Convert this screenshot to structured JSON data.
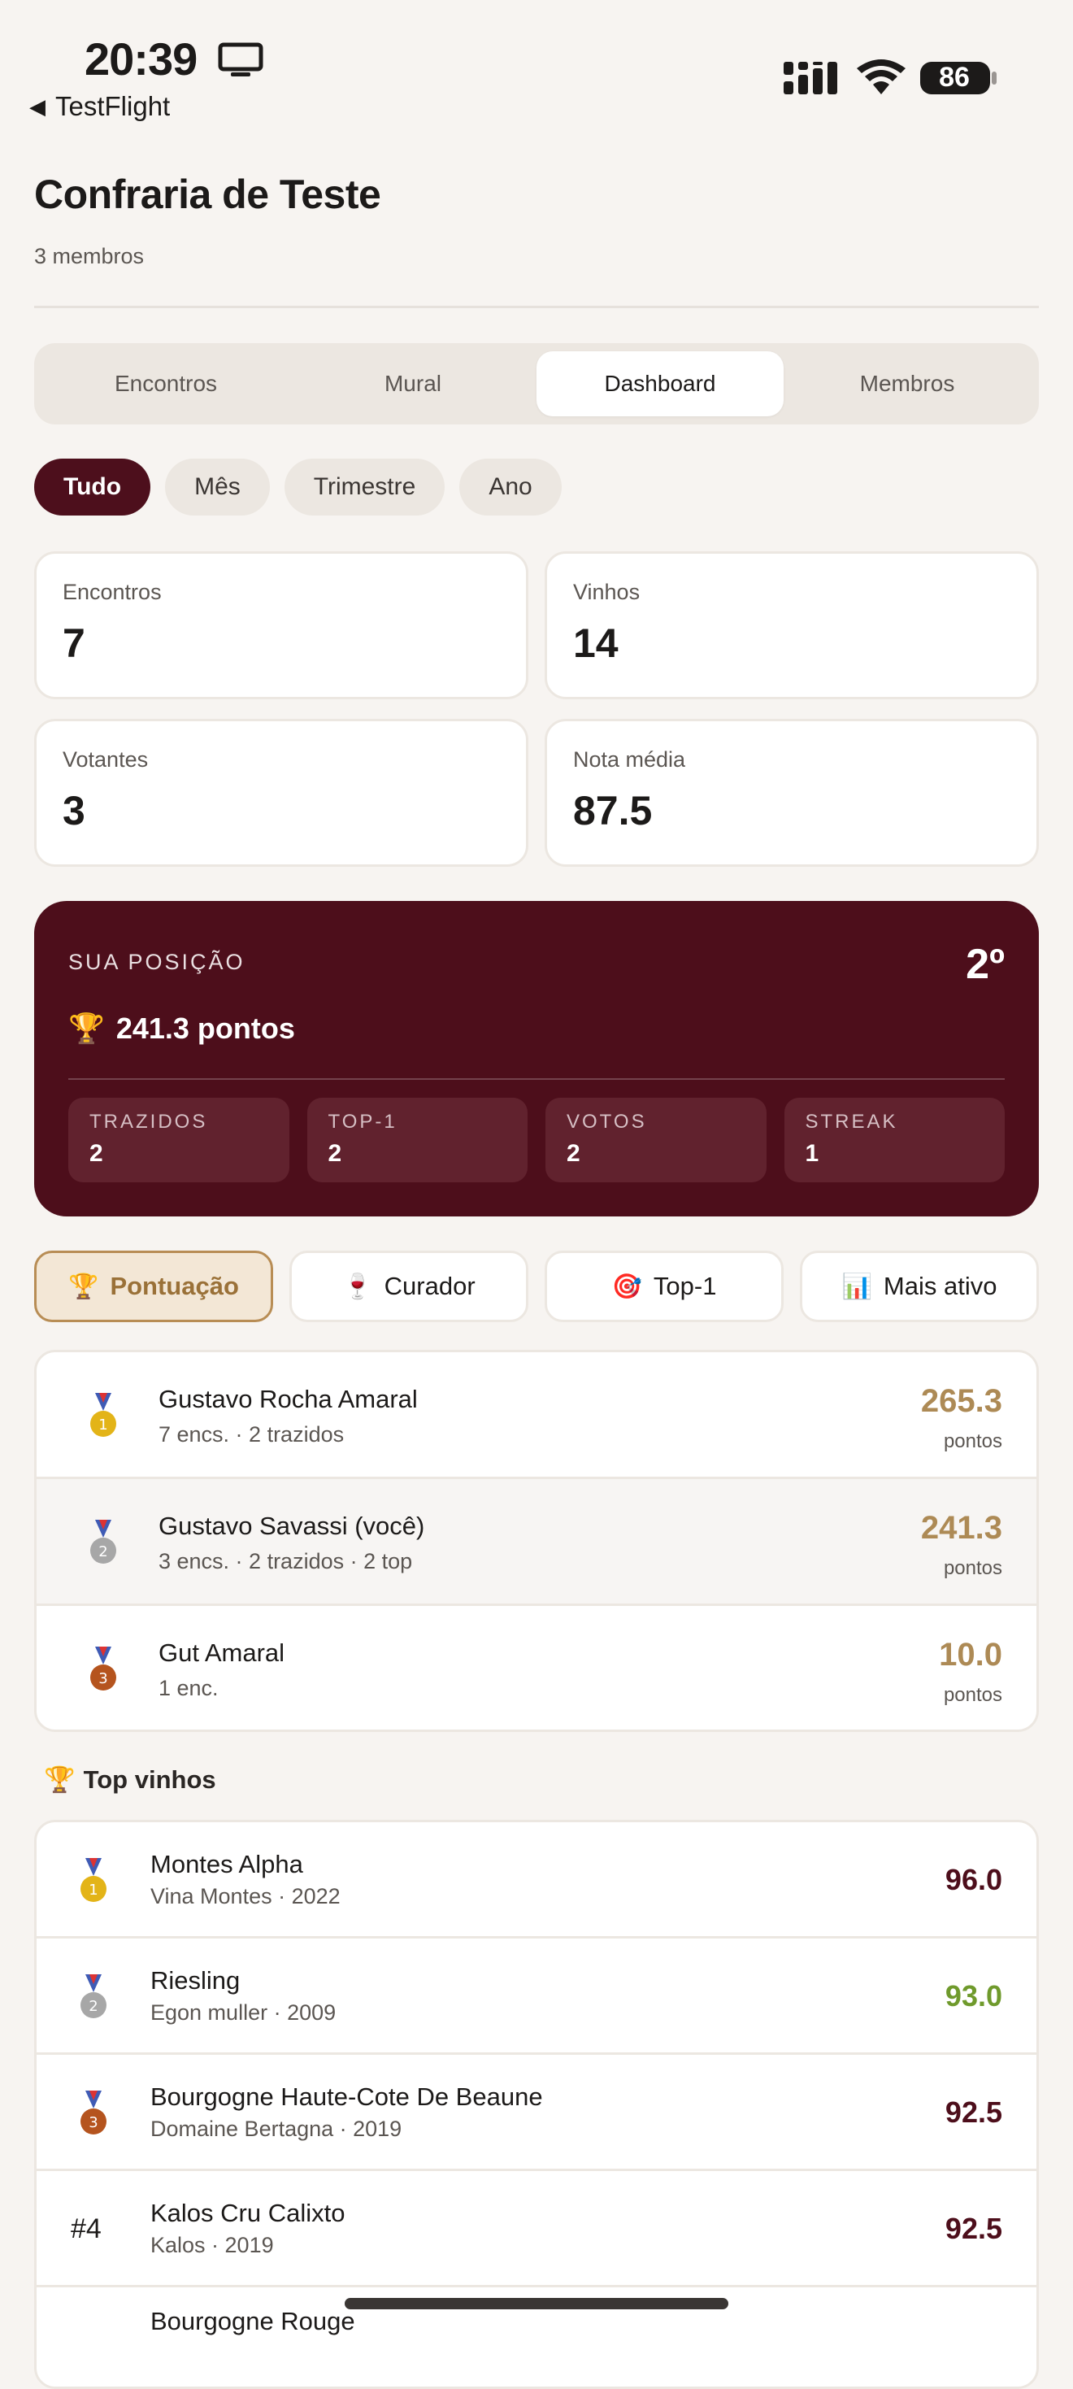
{
  "status_bar": {
    "time": "20:39",
    "back_app": "TestFlight",
    "battery": "86",
    "icons": [
      "tv-icon",
      "signal-icon",
      "wifi-icon",
      "battery-icon"
    ]
  },
  "header": {
    "title": "Confraria de Teste",
    "subtitle": "3 membros"
  },
  "tabs": [
    {
      "label": "Encontros"
    },
    {
      "label": "Mural"
    },
    {
      "label": "Dashboard",
      "active": true
    },
    {
      "label": "Membros"
    }
  ],
  "periods": [
    {
      "label": "Tudo",
      "active": true
    },
    {
      "label": "Mês"
    },
    {
      "label": "Trimestre"
    },
    {
      "label": "Ano"
    }
  ],
  "stats": [
    {
      "label": "Encontros",
      "value": "7"
    },
    {
      "label": "Vinhos",
      "value": "14"
    },
    {
      "label": "Votantes",
      "value": "3"
    },
    {
      "label": "Nota média",
      "value": "87.5"
    }
  ],
  "position": {
    "label": "SUA POSIÇÃO",
    "rank": "2º",
    "trophy": "🏆",
    "points": "241.3 pontos",
    "stats": [
      {
        "label": "TRAZIDOS",
        "value": "2"
      },
      {
        "label": "TOP-1",
        "value": "2"
      },
      {
        "label": "VOTOS",
        "value": "2"
      },
      {
        "label": "STREAK",
        "value": "1"
      }
    ]
  },
  "ranking_tabs": [
    {
      "emoji": "🏆",
      "label": "Pontuação",
      "active": true
    },
    {
      "emoji": "🍷",
      "label": "Curador"
    },
    {
      "emoji": "🎯",
      "label": "Top-1"
    },
    {
      "emoji": "📊",
      "label": "Mais ativo"
    }
  ],
  "leaderboard": [
    {
      "name": "Gustavo Rocha Amaral",
      "meta": "7 encs. · 2 trazidos",
      "score": "265.3",
      "unit": "pontos",
      "medal": "1"
    },
    {
      "name": "Gustavo Savassi (você)",
      "meta": "3 encs. · 2 trazidos · 2 top",
      "score": "241.3",
      "unit": "pontos",
      "medal": "2"
    },
    {
      "name": "Gut Amaral",
      "meta": "1 enc.",
      "score": "10.0",
      "unit": "pontos",
      "medal": "3"
    }
  ],
  "top_wines": {
    "emoji": "🏆",
    "title": "Top vinhos",
    "items": [
      {
        "name": "Montes Alpha",
        "meta": "Vina Montes · 2022",
        "score": "96.0",
        "medal": "1"
      },
      {
        "name": "Riesling",
        "meta": "Egon muller · 2009",
        "score": "93.0",
        "medal": "2"
      },
      {
        "name": "Bourgogne Haute-Cote De Beaune",
        "meta": "Domaine Bertagna · 2019",
        "score": "92.5",
        "medal": "3"
      },
      {
        "rank": "#4",
        "name": "Kalos Cru Calixto",
        "meta": "Kalos · 2019",
        "score": "92.5"
      },
      {
        "name": "Bourgogne Rouge"
      }
    ]
  },
  "colors": {
    "wine": "#4d0e1b",
    "gold": "#ad8a55",
    "green": "#6f9a2c",
    "background": "#f7f4f1"
  }
}
